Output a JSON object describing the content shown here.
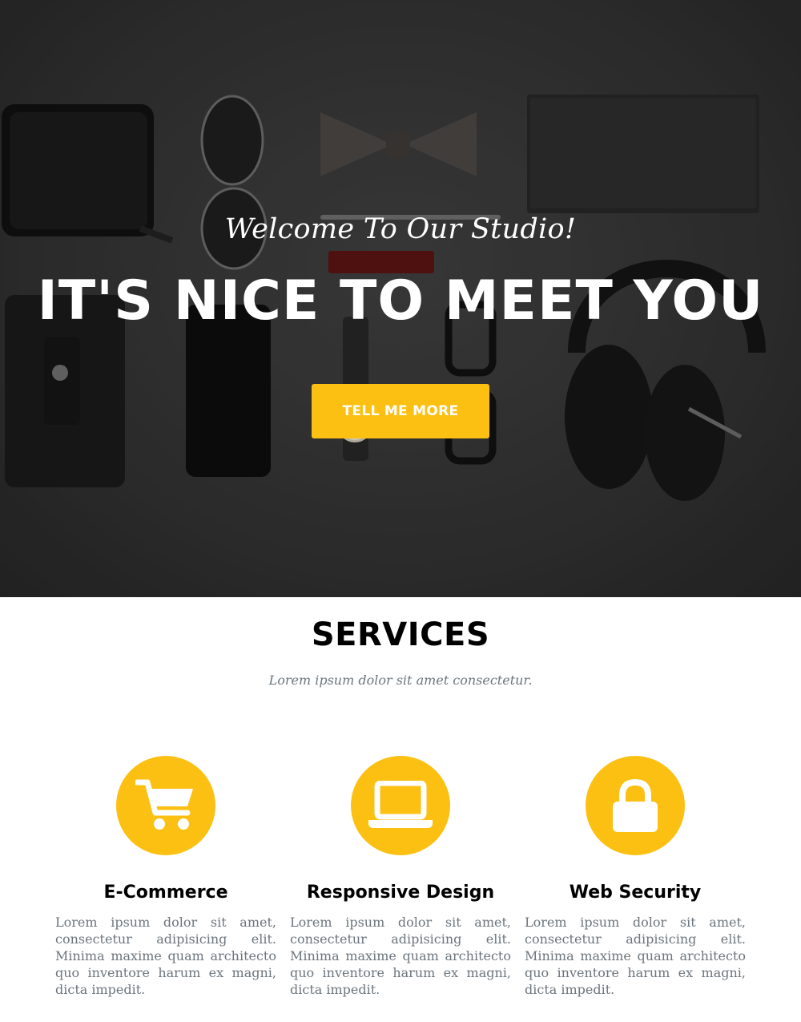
{
  "hero": {
    "subtitle": "Welcome To Our Studio!",
    "title": "IT'S NICE TO MEET YOU",
    "button_label": "TELL ME MORE",
    "accent_color": "#fcc012"
  },
  "services": {
    "heading": "SERVICES",
    "subheading": "Lorem ipsum dolor sit amet consectetur.",
    "items": [
      {
        "icon": "shopping-cart-icon",
        "title": "E-Commerce",
        "text": "Lorem ipsum dolor sit amet, consectetur adipisicing elit. Minima maxime quam architecto quo inventore harum ex magni, dicta impedit."
      },
      {
        "icon": "laptop-icon",
        "title": "Responsive Design",
        "text": "Lorem ipsum dolor sit amet, consectetur adipisicing elit. Minima maxime quam architecto quo inventore harum ex magni, dicta impedit."
      },
      {
        "icon": "lock-icon",
        "title": "Web Security",
        "text": "Lorem ipsum dolor sit amet, consectetur adipisicing elit. Minima maxime quam architecto quo inventore harum ex magni, dicta impedit."
      }
    ]
  }
}
